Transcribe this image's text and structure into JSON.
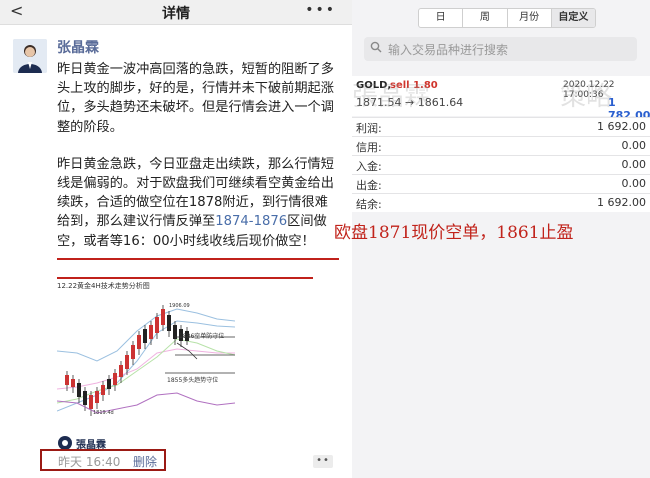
{
  "left_panel": {
    "header_title": "详情",
    "author": "张晶霖",
    "paragraph_1": "昨日黄金一波冲高回落的急跌，短暂的阻断了多头上攻的脚步，好的是，行情并未下破前期起涨位，多头趋势还未破坏。但是行情会进入一个调整的阶段。",
    "paragraph_2_start": "昨日黄金急跌，今日亚盘走出续跌，那么行情短线是偏弱的。对于欧盘我们可继续看空黄金给出续跌，合适的做空位在1878附近，到行情很难给到，那么建议行情反弹至",
    "paragraph_2_link": "1874-1876",
    "paragraph_2_mid": "区间做空，或者等16：00小时线收线后现价做空！",
    "chart": {
      "title": "12.22黄金4H技术走势分析图",
      "top_label": "1906.09",
      "label_short": "1886空单防守位",
      "label_long": "1855多头趋势守位",
      "bottom_label": "1819.4d"
    },
    "logo_text": "張晶霖",
    "footer_time": "昨天 16:40",
    "footer_delete": "删除"
  },
  "right_panel": {
    "tabs": [
      {
        "label": "日"
      },
      {
        "label": "周"
      },
      {
        "label": "月份"
      },
      {
        "label": "自定义",
        "active": true
      }
    ],
    "search_placeholder": "输入交易品种进行搜索",
    "quote": {
      "symbol": "GOLD,",
      "side": "sell 1.80",
      "date": "2020.12.22 17:00:36",
      "price_move": "1871.54 → 1861.64",
      "current_price": "1 782.00"
    },
    "rows": [
      {
        "label": "利润:",
        "value": "1 692.00"
      },
      {
        "label": "信用:",
        "value": "0.00"
      },
      {
        "label": "入金:",
        "value": "0.00"
      },
      {
        "label": "出金:",
        "value": "0.00"
      },
      {
        "label": "结余:",
        "value": "1 692.00"
      }
    ],
    "watermark_1": "張晶霖",
    "watermark_2": "策略"
  },
  "annotation": "欧盘1871现价空单，1861止盈",
  "colors": {
    "author_blue": "#5a6c99",
    "link_blue": "#4a6ea9",
    "annotation_red": "#c1231b",
    "sell_red": "#d0342c",
    "price_blue": "#2a5fcf"
  }
}
